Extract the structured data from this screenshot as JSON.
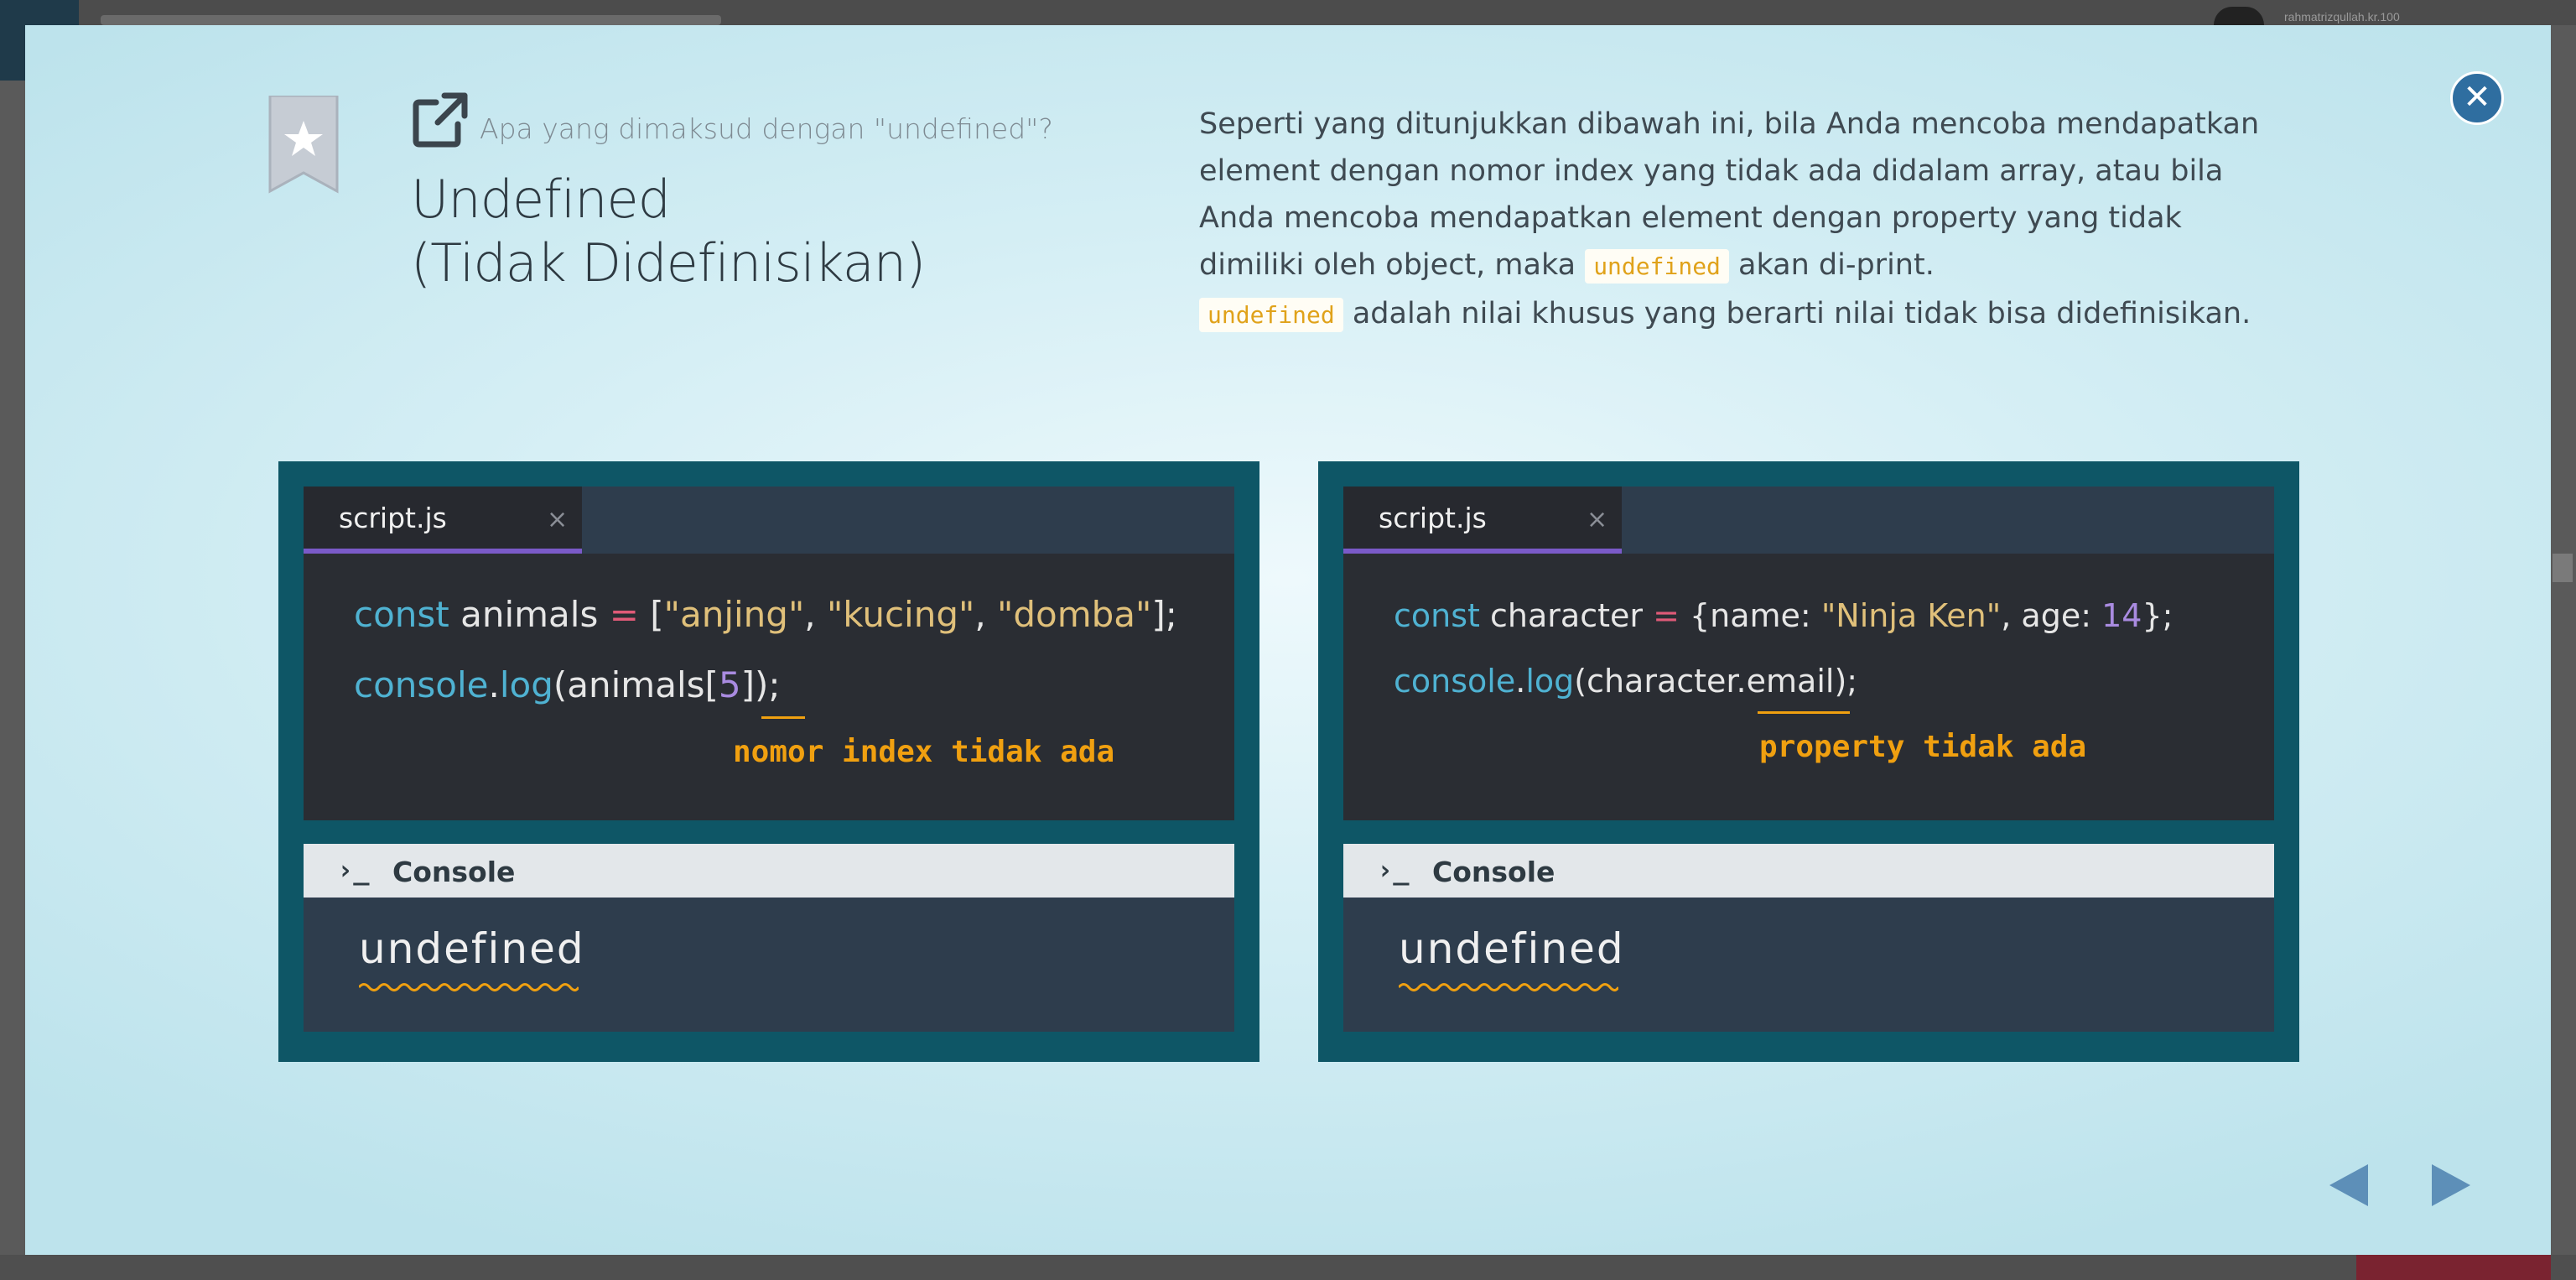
{
  "background": {
    "user_name": "rahmatrizqullah.kr.100"
  },
  "modal": {
    "subtitle": "Apa yang dimaksud dengan \"undefined\"?",
    "title_line1": "Undefined",
    "title_line2": "(Tidak Didefinisikan)",
    "description": {
      "part1": "Seperti yang ditunjukkan dibawah ini, bila Anda mencoba mendapatkan element dengan nomor index yang tidak ada didalam array, atau bila Anda mencoba mendapatkan element dengan property yang tidak dimiliki oleh object, maka ",
      "chip1": "undefined",
      "part2": " akan di-print.",
      "chip2": "undefined",
      "part3": " adalah nilai khusus yang berarti nilai tidak bisa didefinisikan."
    },
    "panels": [
      {
        "tab_name": "script.js",
        "tab_close": "×",
        "line1": {
          "kw": "const",
          "name": " animals ",
          "op": "=",
          "p1": " [",
          "s1": "\"anjing\"",
          "c1": ", ",
          "s2": "\"kucing\"",
          "c2": ", ",
          "s3": "\"domba\"",
          "end": "];"
        },
        "line2": {
          "obj": "console",
          "dot": ".",
          "fn": "log",
          "p1": "(animals[",
          "num": "5",
          "end": "]);"
        },
        "annotation": "nomor index tidak ada",
        "console_prompt": "›_",
        "console_label": "Console",
        "console_output": "undefined"
      },
      {
        "tab_name": "script.js",
        "tab_close": "×",
        "line1": {
          "kw": "const",
          "name": " character ",
          "op": "=",
          "p1": " {name: ",
          "s1": "\"Ninja Ken\"",
          "c1": ", age: ",
          "num": "14",
          "end": "};"
        },
        "line2": {
          "obj": "console",
          "dot": ".",
          "fn": "log",
          "p1": "(character.",
          "prop": "email",
          "end": ");"
        },
        "annotation": "property tidak ada",
        "console_prompt": "›_",
        "console_label": "Console",
        "console_output": "undefined"
      }
    ],
    "close_icon": "close-icon",
    "colors": {
      "panel_bg": "#0e5666",
      "editor_bg": "#2a2d33",
      "keyword": "#4fb2d2",
      "string": "#e0c07a",
      "number": "#a98be0",
      "annotation": "#f0a010",
      "close_button": "#2f6ea0"
    }
  }
}
